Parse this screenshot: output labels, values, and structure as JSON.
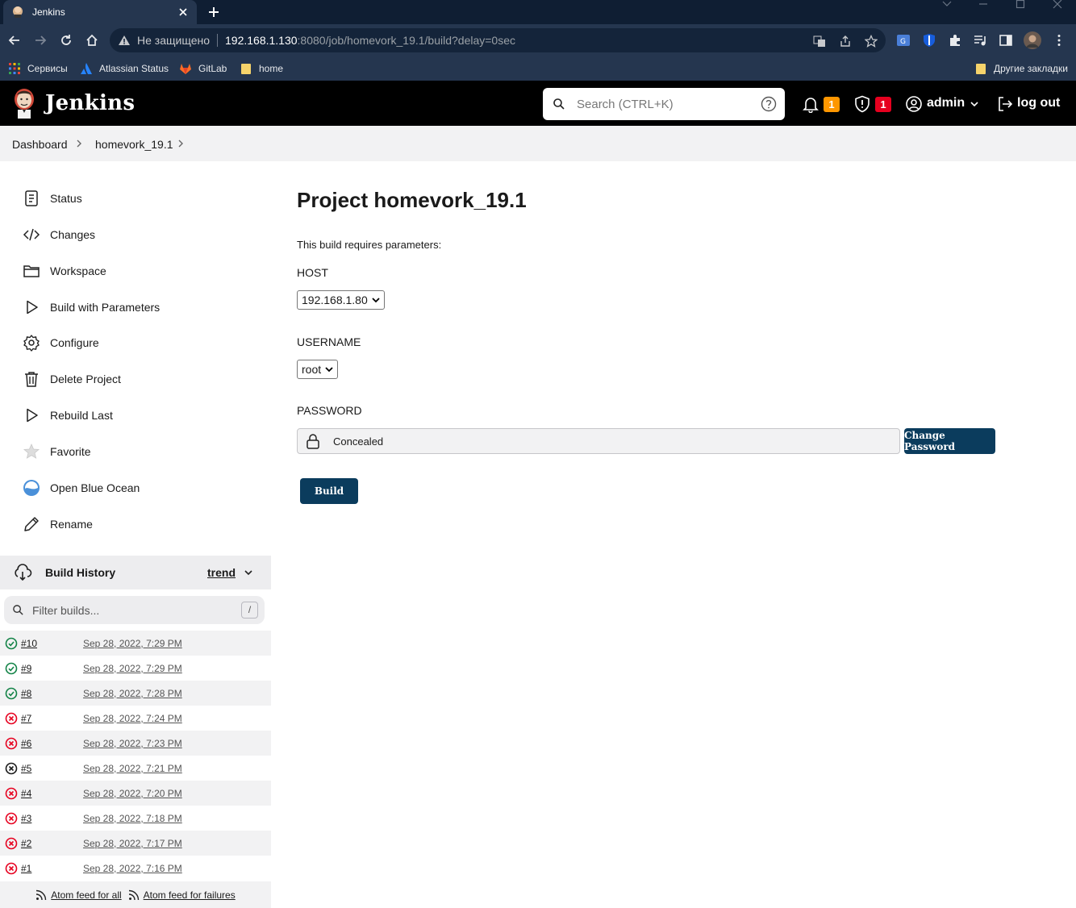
{
  "browser": {
    "tab_title": "Jenkins",
    "insecure_label": "Не защищено",
    "url_host": "192.168.1.130",
    "url_rest": ":8080/job/homevork_19.1/build?delay=0sec",
    "bookmarks": [
      {
        "label": "Сервисы",
        "icon": "apps-grid-icon"
      },
      {
        "label": "Atlassian Status",
        "icon": "atlassian-icon"
      },
      {
        "label": "GitLab",
        "icon": "gitlab-icon"
      },
      {
        "label": "home",
        "icon": "folder-icon"
      }
    ],
    "other_bookmarks": "Другие закладки"
  },
  "header": {
    "brand": "Jenkins",
    "search_placeholder": "Search (CTRL+K)",
    "notifications_count": "1",
    "security_count": "1",
    "user": "admin",
    "logout": "log out"
  },
  "breadcrumb": {
    "items": [
      "Dashboard",
      "homevork_19.1"
    ]
  },
  "sidebar": {
    "items": [
      {
        "label": "Status",
        "icon": "notepad-icon"
      },
      {
        "label": "Changes",
        "icon": "code-icon"
      },
      {
        "label": "Workspace",
        "icon": "folder-icon"
      },
      {
        "label": "Build with Parameters",
        "icon": "play-icon"
      },
      {
        "label": "Configure",
        "icon": "gear-icon"
      },
      {
        "label": "Delete Project",
        "icon": "trash-icon"
      },
      {
        "label": "Rebuild Last",
        "icon": "play-icon"
      },
      {
        "label": "Favorite",
        "icon": "star-icon"
      },
      {
        "label": "Open Blue Ocean",
        "icon": "blue-ocean-icon"
      },
      {
        "label": "Rename",
        "icon": "pencil-icon"
      }
    ]
  },
  "build_history": {
    "title": "Build History",
    "trend": "trend",
    "filter_placeholder": "Filter builds...",
    "filter_shortcut": "/",
    "builds": [
      {
        "num": "#10",
        "date": "Sep 28, 2022, 7:29 PM",
        "status": "success"
      },
      {
        "num": "#9",
        "date": "Sep 28, 2022, 7:29 PM",
        "status": "success"
      },
      {
        "num": "#8",
        "date": "Sep 28, 2022, 7:28 PM",
        "status": "success"
      },
      {
        "num": "#7",
        "date": "Sep 28, 2022, 7:24 PM",
        "status": "failed"
      },
      {
        "num": "#6",
        "date": "Sep 28, 2022, 7:23 PM",
        "status": "failed"
      },
      {
        "num": "#5",
        "date": "Sep 28, 2022, 7:21 PM",
        "status": "aborted"
      },
      {
        "num": "#4",
        "date": "Sep 28, 2022, 7:20 PM",
        "status": "failed"
      },
      {
        "num": "#3",
        "date": "Sep 28, 2022, 7:18 PM",
        "status": "failed"
      },
      {
        "num": "#2",
        "date": "Sep 28, 2022, 7:17 PM",
        "status": "failed"
      },
      {
        "num": "#1",
        "date": "Sep 28, 2022, 7:16 PM",
        "status": "failed"
      }
    ],
    "feed_all": "Atom feed for all",
    "feed_failures": "Atom feed for failures"
  },
  "main": {
    "title": "Project homevork_19.1",
    "description": "This build requires parameters:",
    "params": {
      "host_label": "HOST",
      "host_value": "192.168.1.80",
      "username_label": "USERNAME",
      "username_value": "root",
      "password_label": "PASSWORD",
      "password_value": "Concealed",
      "change_password": "Change Password"
    },
    "build_button": "Build"
  },
  "colors": {
    "accent_dark": "#0b3c5d",
    "success": "#138347",
    "failure": "#e6001f",
    "notification_badge": "#fe9700",
    "security_badge": "#e6001f"
  }
}
